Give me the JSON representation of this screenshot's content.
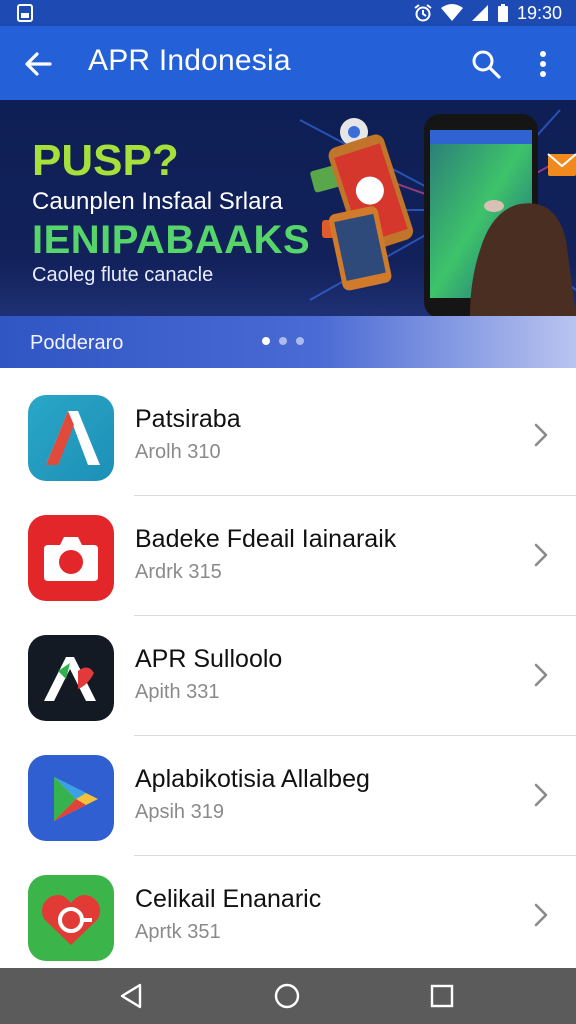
{
  "status_bar": {
    "time": "19:30",
    "icons": [
      "sim-card-icon",
      "alarm-icon",
      "wifi-icon",
      "signal-icon",
      "battery-icon"
    ]
  },
  "app_bar": {
    "title": "APR Indonesia",
    "back_icon": "arrow-back-icon",
    "search_icon": "search-icon",
    "more_icon": "more-vertical-icon"
  },
  "banner": {
    "heading": "PUSP?",
    "line1": "Caunplen Insfaal Srlara",
    "line2": "IENIPABAAKS",
    "line3": "Caoleg flute canacle",
    "caption": "Podderaro",
    "page_count": 3,
    "active_page": 1
  },
  "apps": [
    {
      "name": "Patsiraba",
      "meta": "Arolh 310",
      "icon": "letter-a-teal-icon"
    },
    {
      "name": "Badeke Fdeail Iainaraik",
      "meta": "Ardrk 315",
      "icon": "camera-red-icon"
    },
    {
      "name": "APR Sulloolo",
      "meta": "Apith 331",
      "icon": "letter-a-dark-icon"
    },
    {
      "name": "Aplabikotisia Allalbeg",
      "meta": "Apsih 319",
      "icon": "play-triangle-blue-icon"
    },
    {
      "name": "Celikail Enanaric",
      "meta": "Aprtk 351",
      "icon": "heart-green-icon"
    }
  ],
  "nav_bar": {
    "buttons": [
      "back-triangle-icon",
      "home-circle-icon",
      "recents-square-icon"
    ]
  },
  "colors": {
    "status_bar": "#1d4bb3",
    "app_bar": "#2460d8",
    "banner_heading": "#a6e03a",
    "banner_accent": "#56d66a",
    "nav_bar": "#5b5b5b"
  }
}
